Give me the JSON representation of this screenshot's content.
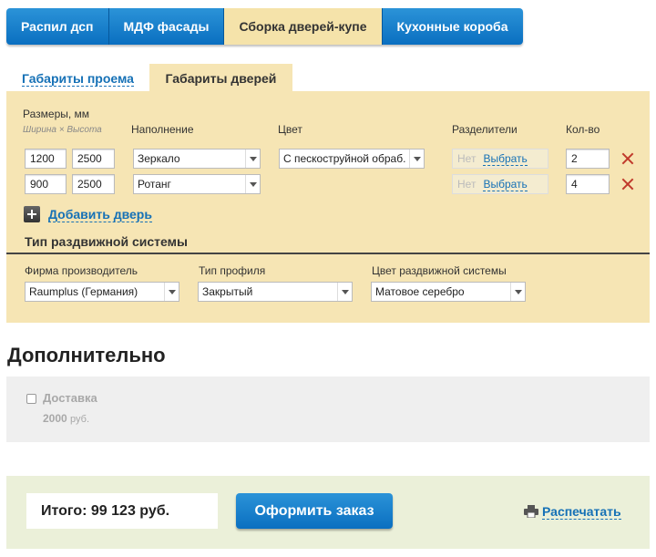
{
  "topnav": {
    "items": [
      "Распил дсп",
      "МДФ фасады",
      "Сборка дверей-купе",
      "Кухонные короба"
    ],
    "active_index": 2
  },
  "tabs": {
    "opening": "Габариты проема",
    "doors": "Габариты дверей"
  },
  "doors": {
    "sizes_label": "Размеры, мм",
    "sizes_sub": "Ширина × Высота",
    "fill_label": "Наполнение",
    "color_label": "Цвет",
    "dividers_label": "Разделители",
    "qty_label": "Кол-во",
    "rows": [
      {
        "width": "1200",
        "height": "2500",
        "fill": "Зеркало",
        "color": "С пескоструйной обраб.",
        "dividers": "Нет",
        "select": "Выбрать",
        "qty": "2"
      },
      {
        "width": "900",
        "height": "2500",
        "fill": "Ротанг",
        "color": "",
        "dividers": "Нет",
        "select": "Выбрать",
        "qty": "4"
      }
    ],
    "add_label": "Добавить дверь"
  },
  "sliding": {
    "title": "Тип раздвижной системы",
    "maker_label": "Фирма производитель",
    "maker_value": "Raumplus (Германия)",
    "profile_label": "Тип профиля",
    "profile_value": "Закрытый",
    "color_label": "Цвет раздвижной системы",
    "color_value": "Матовое серебро"
  },
  "extra": {
    "title": "Дополнительно",
    "delivery_label": "Доставка",
    "delivery_price": "2000",
    "currency": "руб."
  },
  "footer": {
    "total": "Итого: 99 123 руб.",
    "order_button": "Оформить заказ",
    "print_label": "Распечатать"
  },
  "colors": {
    "accent_blue": "#0a6fc0",
    "panel_beige": "#f6e5b4",
    "footer_green": "#ebf0d9",
    "delete_red": "#c0392b"
  }
}
